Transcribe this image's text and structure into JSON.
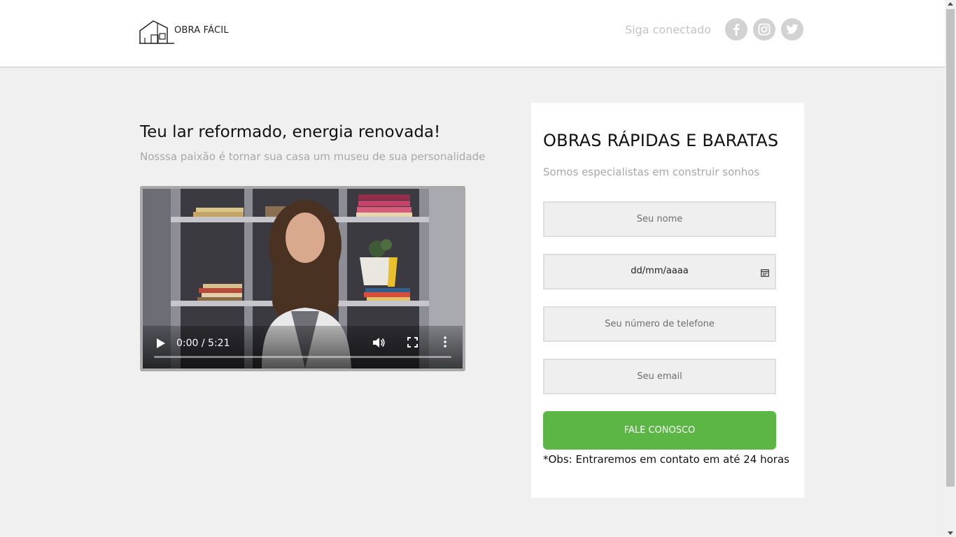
{
  "header": {
    "brand": "OBRA FÁCIL",
    "social_label": "Siga conectado",
    "social_icons": [
      "facebook-icon",
      "instagram-icon",
      "twitter-icon"
    ]
  },
  "hero": {
    "headline": "Teu lar reformado, energia renovada!",
    "subheadline": "Nosssa paixão é tornar sua casa um museu de sua personalidade"
  },
  "video": {
    "time": "0:00 / 5:21",
    "progress": 0
  },
  "form": {
    "title": "OBRAS RÁPIDAS E BARATAS",
    "subtitle": "Somos especialistas em construir sonhos",
    "name_placeholder": "Seu nome",
    "date_value": "dd/mm/aaaa",
    "phone_placeholder": "Seu número de telefone",
    "email_placeholder": "Seu email",
    "submit_label": "FALE CONOSCO",
    "note": "*Obs: Entraremos em contato em até 24 horas"
  },
  "colors": {
    "accent": "#5cb645",
    "background": "#f0f0f0",
    "muted_text": "#a8a8a8"
  }
}
